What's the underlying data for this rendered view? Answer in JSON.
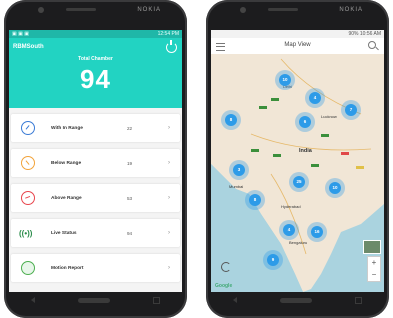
{
  "phone1": {
    "brand": "NOKIA",
    "status_left": "▣ ▣ ▣",
    "status_right": "12:54 PM",
    "app_title": "RBMSouth",
    "total_label": "Total Chamber",
    "total_value": "94",
    "items": [
      {
        "label": "With In Range",
        "count": "22",
        "icon": "gauge-icon",
        "color": "#3a7bd5"
      },
      {
        "label": "Below Range",
        "count": "19",
        "icon": "gauge-low-icon",
        "color": "#f2a33a"
      },
      {
        "label": "Above Range",
        "count": "53",
        "icon": "gauge-high-icon",
        "color": "#e8454d"
      },
      {
        "label": "Live Status",
        "count": "94",
        "icon": "live-signal-icon",
        "color": "#2a8c4a"
      },
      {
        "label": "Motion Report",
        "count": "",
        "icon": "motion-report-icon",
        "color": "#4caf50"
      }
    ]
  },
  "phone2": {
    "brand": "NOKIA",
    "status_right": "90% 10:56 AM",
    "title": "Map View",
    "map_labels": [
      "India",
      "Lucknow",
      "Bengaluru",
      "Hyderabad",
      "Mumbai",
      "Delhi"
    ],
    "clusters": [
      "10",
      "4",
      "7",
      "8",
      "6",
      "25",
      "3",
      "8",
      "10",
      "4",
      "16",
      "9"
    ],
    "google": "Google"
  },
  "colors": {
    "teal": "#22d3c2",
    "marker": "#2d9be8"
  }
}
